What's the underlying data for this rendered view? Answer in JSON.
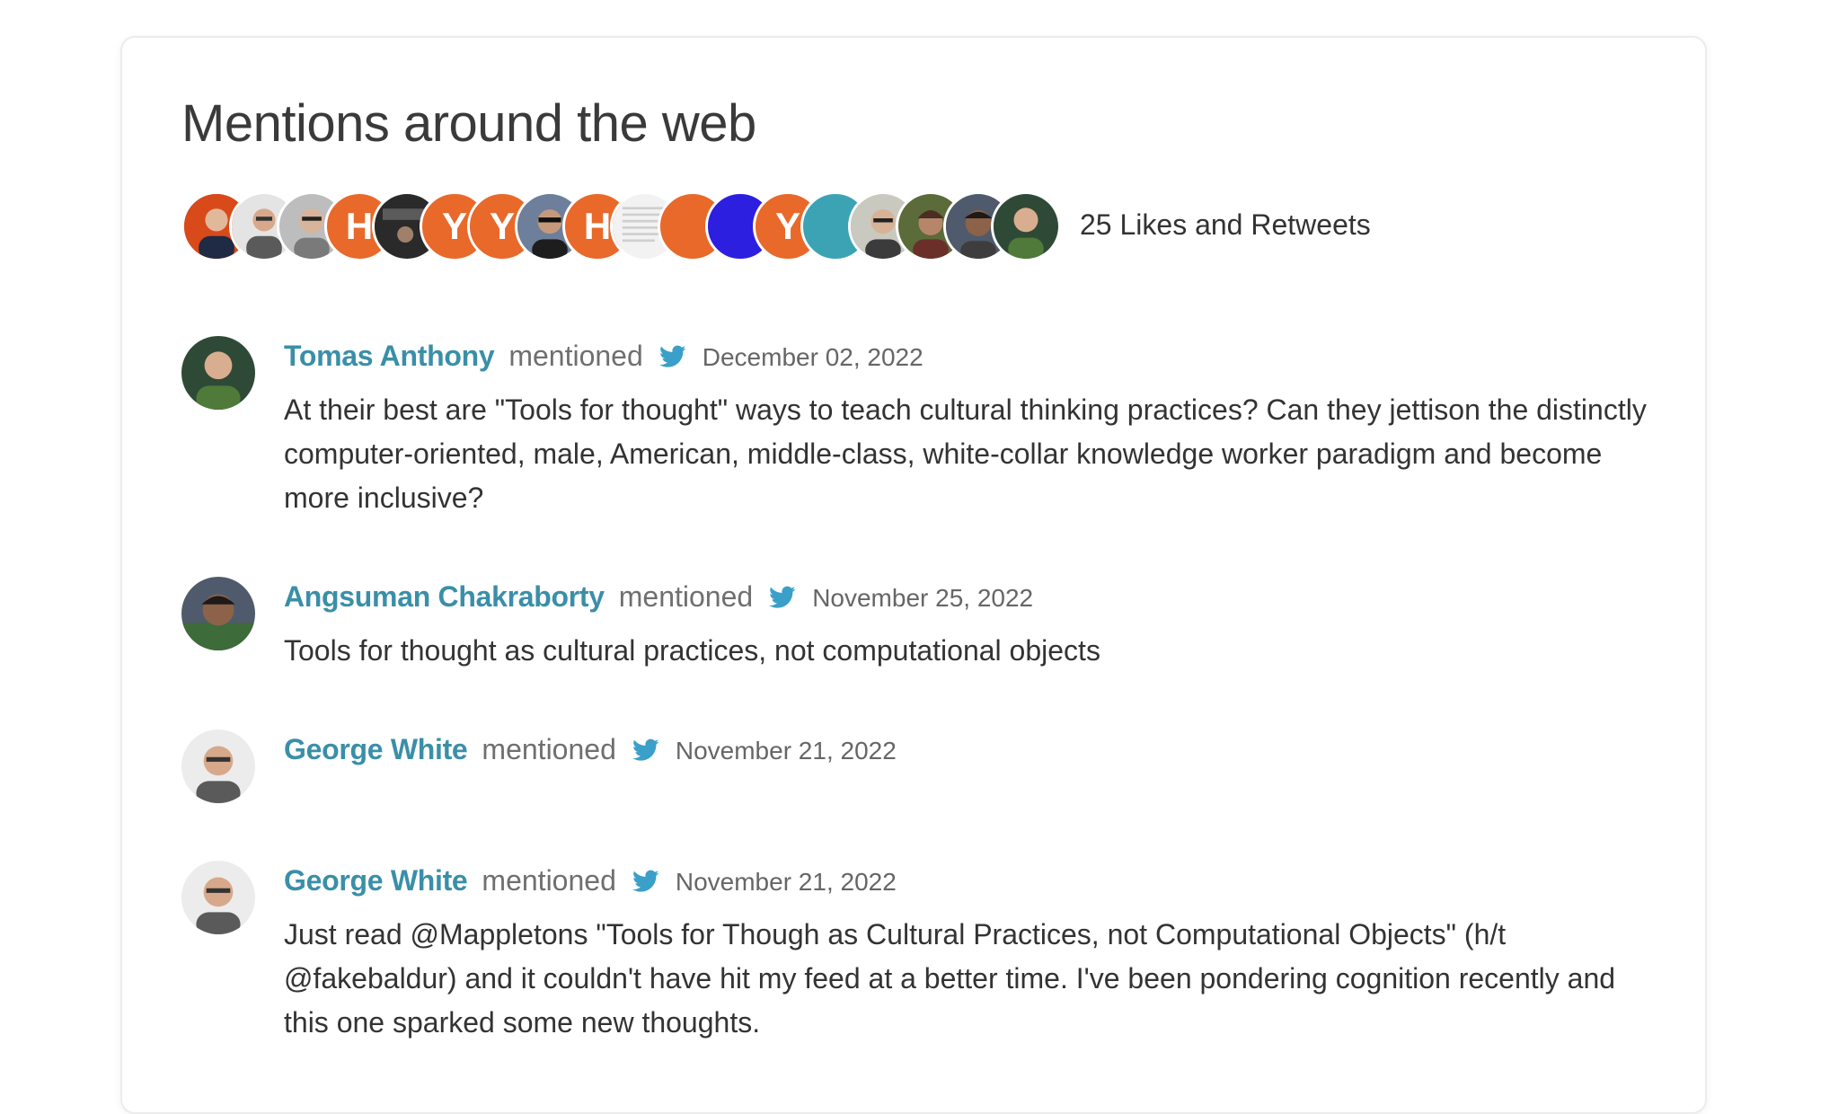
{
  "section": {
    "title": "Mentions around the web",
    "likes_label": "25 Likes and Retweets"
  },
  "facepile": [
    {
      "icon": "photo-avatar",
      "bg": "#d84a1a"
    },
    {
      "icon": "photo-avatar",
      "bg": "#e0e0e0"
    },
    {
      "icon": "photo-avatar",
      "bg": "#bdbdbd"
    },
    {
      "icon": "hn-avatar",
      "letter": "H",
      "bg": "#e8692a"
    },
    {
      "icon": "photo-avatar",
      "bg": "#2a2a2a"
    },
    {
      "icon": "yc-avatar",
      "letter": "Y",
      "bg": "#e8692a"
    },
    {
      "icon": "yc-avatar",
      "letter": "Y",
      "bg": "#e8692a"
    },
    {
      "icon": "photo-avatar",
      "bg": "#6d7f9a"
    },
    {
      "icon": "hn-avatar",
      "letter": "H",
      "bg": "#e8692a"
    },
    {
      "icon": "document-avatar",
      "bg": "#f2f2f2"
    },
    {
      "icon": "plain-avatar",
      "bg": "#e8692a"
    },
    {
      "icon": "plain-avatar",
      "bg": "#2d1fe0"
    },
    {
      "icon": "yc-avatar",
      "letter": "Y",
      "bg": "#e8692a"
    },
    {
      "icon": "plain-avatar",
      "bg": "#3ca3b5"
    },
    {
      "icon": "photo-avatar",
      "bg": "#c9c9c0"
    },
    {
      "icon": "photo-avatar",
      "bg": "#6b4a3a"
    },
    {
      "icon": "photo-avatar",
      "bg": "#4f5b6c"
    },
    {
      "icon": "photo-avatar",
      "bg": "#2e4a36"
    }
  ],
  "mentions": [
    {
      "name": "Tomas Anthony",
      "verb": "mentioned",
      "source_icon": "twitter-icon",
      "date": "December 02, 2022",
      "text": "At their best are \"Tools for thought\" ways to teach cultural thinking practices? Can they jettison the distinctly computer-oriented, male, American, middle-class, white-collar knowledge worker paradigm and become more inclusive?"
    },
    {
      "name": "Angsuman Chakraborty",
      "verb": "mentioned",
      "source_icon": "twitter-icon",
      "date": "November 25, 2022",
      "text": "Tools for thought as cultural practices, not computational objects"
    },
    {
      "name": "George White",
      "verb": "mentioned",
      "source_icon": "twitter-icon",
      "date": "November 21, 2022",
      "text": ""
    },
    {
      "name": "George White",
      "verb": "mentioned",
      "source_icon": "twitter-icon",
      "date": "November 21, 2022",
      "text": "Just read @Mappletons \"Tools for Though as Cultural Practices, not Computational Objects\" (h/t @fakebaldur) and it couldn't have hit my feed at a better time. I've been pondering cognition recently and this one sparked some new thoughts."
    }
  ],
  "colors": {
    "accent": "#3a8fa8",
    "twitter": "#3aa0c9",
    "card_border": "#ececec"
  }
}
